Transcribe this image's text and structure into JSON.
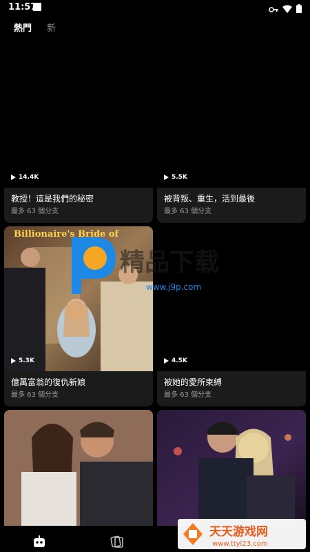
{
  "status": {
    "time": "11:57"
  },
  "tabs": [
    {
      "label": "熱門",
      "active": true
    },
    {
      "label": "新",
      "active": false
    }
  ],
  "cards": [
    {
      "views": "14.4K",
      "title": "教授！這是我們的秘密",
      "sub": "最多 63 個分支"
    },
    {
      "views": "5.5K",
      "title": "被背叛、重生，活到最後",
      "sub": "最多 63 個分支"
    },
    {
      "views": "5.3K",
      "title": "億萬富翁的復仇新娘",
      "sub": "最多 63 個分支",
      "poster_text": "Billionaire's Bride of"
    },
    {
      "views": "4.5K",
      "title": "被她的愛所束縛",
      "sub": "最多 63 個分支"
    }
  ],
  "watermark": {
    "text": "精品下载",
    "url": "www.j9p.com"
  },
  "watermark2": {
    "text": "天天游戏网",
    "url": "www.ttyl23.com"
  },
  "colors": {
    "background": "#000000",
    "card": "#1b1b1b",
    "subtext": "#9a9a9a",
    "accent_orange": "#f5a623",
    "accent_blue": "#1e88e5"
  }
}
